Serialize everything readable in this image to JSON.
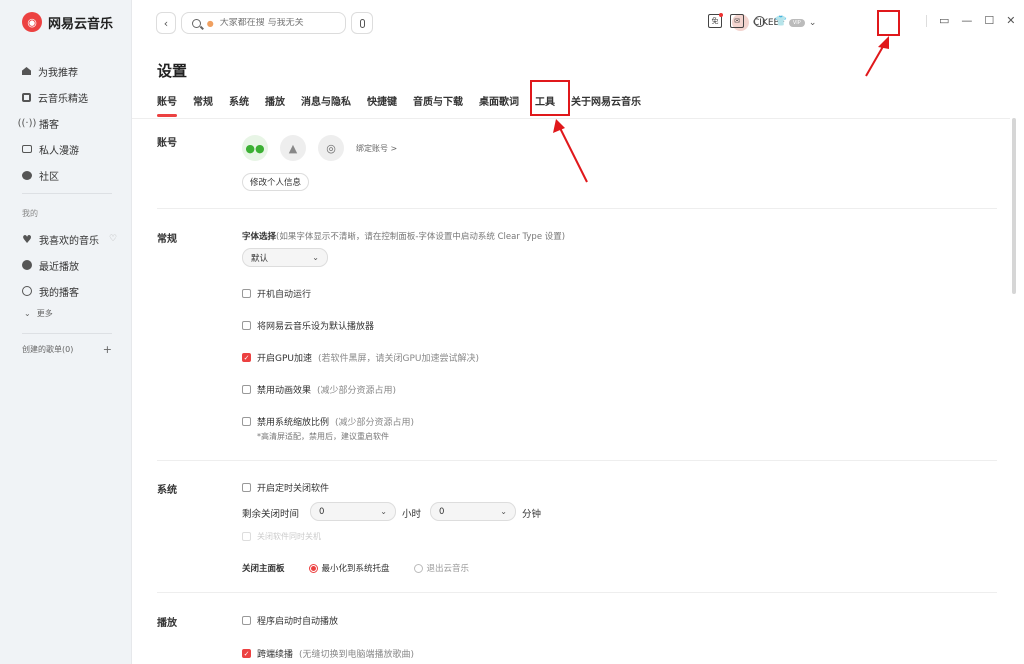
{
  "app": {
    "name": "网易云音乐",
    "logo_glyph": "◉"
  },
  "sidebar": {
    "items": [
      {
        "label": "为我推荐",
        "icon": "home-icon"
      },
      {
        "label": "云音乐精选",
        "icon": "music-note-icon"
      },
      {
        "label": "播客",
        "icon": "radio-icon"
      },
      {
        "label": "私人漫游",
        "icon": "roam-icon"
      },
      {
        "label": "社区",
        "icon": "chat-icon"
      }
    ],
    "my_label": "我的",
    "my_items": [
      {
        "label": "我喜欢的音乐",
        "icon": "heart-icon"
      },
      {
        "label": "最近播放",
        "icon": "clock-icon"
      },
      {
        "label": "我的播客",
        "icon": "podcast-icon"
      }
    ],
    "more": "更多",
    "created_playlists": "创建的歌单(0)",
    "add": "+"
  },
  "topbar": {
    "back": "‹",
    "search_placeholder": "大家都在搜 与我无关",
    "username": "CIKEBF",
    "vip": "VIP",
    "dropdown": "⌄",
    "icons": [
      "badge-icon",
      "mail-icon",
      "settings-icon",
      "skin-icon"
    ],
    "window": [
      "mini-player-icon",
      "minimize-icon",
      "maximize-icon",
      "close-icon"
    ],
    "win_glyphs": [
      "▭",
      "—",
      "☐",
      "✕"
    ]
  },
  "settings": {
    "title": "设置",
    "tabs": [
      "账号",
      "常规",
      "系统",
      "播放",
      "消息与隐私",
      "快捷键",
      "音质与下载",
      "桌面歌词",
      "工具",
      "关于网易云音乐"
    ],
    "account": {
      "title": "账号",
      "bind": "绑定账号 >",
      "edit": "修改个人信息"
    },
    "general": {
      "title": "常规",
      "font_label": "字体选择",
      "font_hint": "(如果字体显示不清晰，请在控制面板-字体设置中启动系统 Clear Type 设置)",
      "font_value": "默认",
      "options": [
        {
          "label": "开机自动运行",
          "hint": "",
          "checked": false
        },
        {
          "label": "将网易云音乐设为默认播放器",
          "hint": "",
          "checked": false
        },
        {
          "label": "开启GPU加速",
          "hint": "(若软件黑屏，请关闭GPU加速尝试解决)",
          "checked": true
        },
        {
          "label": "禁用动画效果",
          "hint": "(减少部分资源占用)",
          "checked": false
        },
        {
          "label": "禁用系统缩放比例",
          "hint": "(减少部分资源占用)",
          "checked": false
        }
      ],
      "note": "*高清屏适配，禁用后，建议重启软件"
    },
    "system": {
      "title": "系统",
      "timer": "开启定时关闭软件",
      "remaining": "剩余关闭时间",
      "hours_value": "0",
      "hours_unit": "小时",
      "minutes_value": "0",
      "minutes_unit": "分钟",
      "shutdown": "关闭软件同时关机",
      "close_panel": "关闭主面板",
      "radio_minimize": "最小化到系统托盘",
      "radio_exit": "退出云音乐"
    },
    "playback": {
      "title": "播放",
      "options": [
        {
          "label": "程序启动时自动播放",
          "hint": "",
          "checked": false
        },
        {
          "label": "跨端续播",
          "hint": "(无缝切换到电脑端播放歌曲)",
          "checked": true
        }
      ]
    }
  },
  "colors": {
    "accent": "#ec4141",
    "highlight": "#e0181b"
  }
}
